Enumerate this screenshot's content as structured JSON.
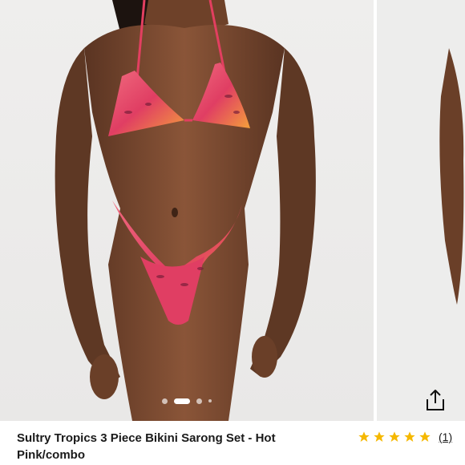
{
  "product": {
    "title": "Sultry Tropics 3 Piece Bikini Sarong Set - Hot Pink/combo",
    "rating_value": 5,
    "rating_max": 5,
    "review_count": "(1)"
  },
  "gallery": {
    "image_alt": "Model wearing pink animal-print triangle bikini",
    "dots_total": 4,
    "active_dot": 2
  },
  "icons": {
    "share": "share-icon",
    "star": "star-icon"
  },
  "colors": {
    "star": "#f5b800",
    "bikini_primary": "#e8456a",
    "bikini_accent": "#f6a23a"
  }
}
